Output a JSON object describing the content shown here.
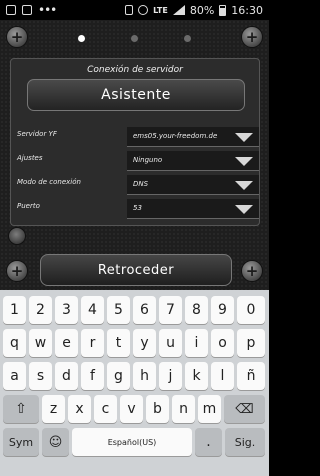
{
  "statusbar": {
    "battery": "80%",
    "time": "16:30",
    "network": "LTE"
  },
  "app": {
    "pager_dots": 3,
    "panel_title": "Conexión de servidor",
    "wizard_button": "Asistente",
    "fields": [
      {
        "label": "Servidor YF",
        "value": "ems05.your-freedom.de"
      },
      {
        "label": "Ajustes",
        "value": "Ninguno"
      },
      {
        "label": "Modo de conexión",
        "value": "DNS"
      },
      {
        "label": "Puerto",
        "value": "53"
      }
    ],
    "back_button": "Retroceder"
  },
  "keyboard": {
    "row1": [
      "1",
      "2",
      "3",
      "4",
      "5",
      "6",
      "7",
      "8",
      "9",
      "0"
    ],
    "row2": [
      "q",
      "w",
      "e",
      "r",
      "t",
      "y",
      "u",
      "i",
      "o",
      "p"
    ],
    "row3": [
      "a",
      "s",
      "d",
      "f",
      "g",
      "h",
      "j",
      "k",
      "l",
      "ñ"
    ],
    "row4": [
      "z",
      "x",
      "c",
      "v",
      "b",
      "n",
      "m"
    ],
    "sym_label": "Sym",
    "space_label": "Español(US)",
    "period_label": ".",
    "sig_label": "Sig."
  }
}
